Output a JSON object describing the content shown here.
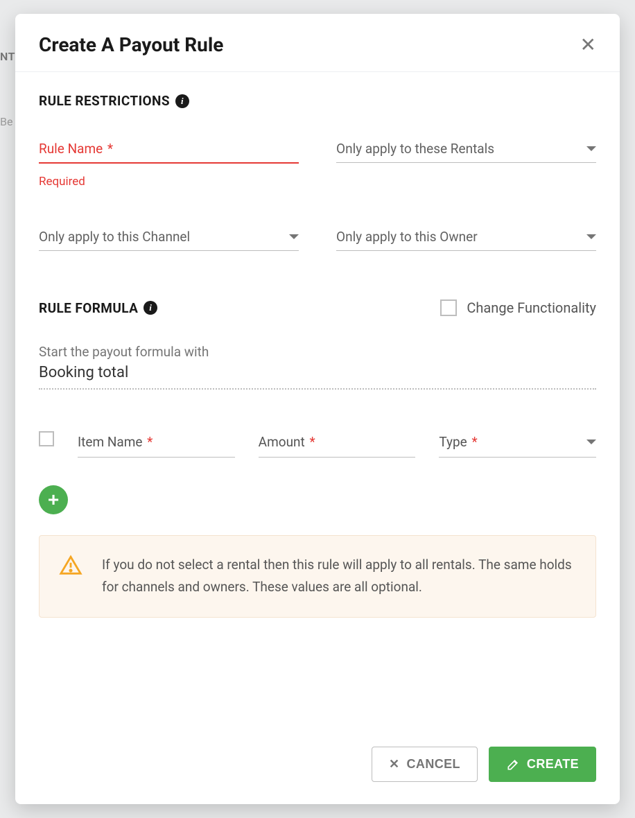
{
  "background": {
    "leftHint1": "NT",
    "leftHint2": "Be"
  },
  "modal": {
    "title": "Create A Payout Rule",
    "sections": {
      "restrictions": {
        "heading": "RULE RESTRICTIONS",
        "ruleName": {
          "label": "Rule Name",
          "helper": "Required"
        },
        "rentals": {
          "label": "Only apply to these Rentals"
        },
        "channel": {
          "label": "Only apply to this Channel"
        },
        "owner": {
          "label": "Only apply to this Owner"
        }
      },
      "formula": {
        "heading": "RULE FORMULA",
        "changeFunctionality": "Change Functionality",
        "startHint": "Start the payout formula with",
        "startValue": "Booking total",
        "lineItem": {
          "itemName": "Item Name",
          "amount": "Amount",
          "type": "Type"
        }
      }
    },
    "alertText": "If you do not select a rental then this rule will apply to all rentals. The same holds for channels and owners. These values are all optional.",
    "footer": {
      "cancel": "CANCEL",
      "create": "CREATE"
    }
  },
  "glyphs": {
    "info": "i",
    "plus": "+",
    "x": "✕"
  }
}
